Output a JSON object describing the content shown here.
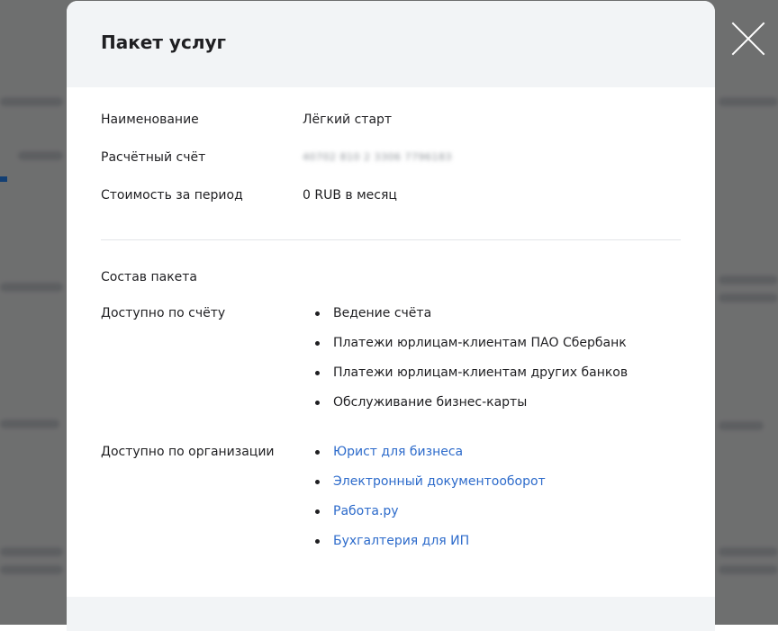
{
  "modal": {
    "title": "Пакет услуг",
    "info": [
      {
        "label": "Наименование",
        "value": "Лёгкий старт"
      },
      {
        "label": "Расчётный счёт",
        "value": "40702 810 2 3306 7796183"
      },
      {
        "label": "Стоимость за период",
        "value": "0 RUB в месяц"
      }
    ],
    "package_title": "Состав пакета",
    "account_group": {
      "label": "Доступно по счёту",
      "items": [
        "Ведение счёта",
        "Платежи юрлицам-клиентам ПАО Сбербанк",
        "Платежи юрлицам-клиентам других банков",
        "Обслуживание бизнес-карты"
      ]
    },
    "org_group": {
      "label": "Доступно по организации",
      "items": [
        "Юрист для бизнеса",
        "Электронный документооборот",
        "Работа.ру",
        "Бухгалтерия для ИП"
      ]
    }
  },
  "colors": {
    "link": "#2d6bcb",
    "overlay": "rgba(0,0,0,0.55)",
    "header_bg": "#f2f4f6"
  },
  "icons": {
    "close": "close-icon"
  }
}
